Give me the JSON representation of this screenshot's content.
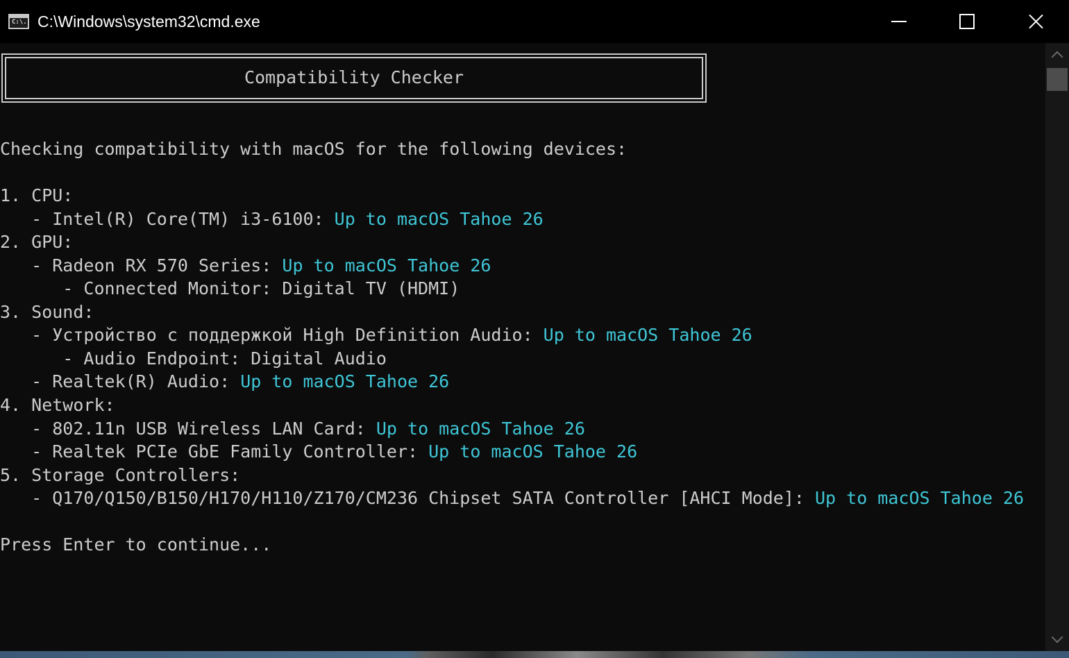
{
  "window": {
    "title": "C:\\Windows\\system32\\cmd.exe",
    "icon_text": "C:\\.",
    "icon": "console-icon",
    "controls": [
      "minimize-icon",
      "maximize-icon",
      "close-icon"
    ]
  },
  "console": {
    "banner": "Compatibility Checker",
    "lines": [
      {
        "text": "Checking compatibility with macOS for the following devices:",
        "status": ""
      },
      {
        "text": "",
        "status": ""
      },
      {
        "text": "1. CPU:",
        "status": ""
      },
      {
        "text": "   - Intel(R) Core(TM) i3-6100: ",
        "status": "Up to macOS Tahoe 26"
      },
      {
        "text": "2. GPU:",
        "status": ""
      },
      {
        "text": "   - Radeon RX 570 Series: ",
        "status": "Up to macOS Tahoe 26"
      },
      {
        "text": "      - Connected Monitor: Digital TV (HDMI)",
        "status": ""
      },
      {
        "text": "3. Sound:",
        "status": ""
      },
      {
        "text": "   - Устройство с поддержкой High Definition Audio: ",
        "status": "Up to macOS Tahoe 26"
      },
      {
        "text": "      - Audio Endpoint: Digital Audio",
        "status": ""
      },
      {
        "text": "   - Realtek(R) Audio: ",
        "status": "Up to macOS Tahoe 26"
      },
      {
        "text": "4. Network:",
        "status": ""
      },
      {
        "text": "   - 802.11n USB Wireless LAN Card: ",
        "status": "Up to macOS Tahoe 26"
      },
      {
        "text": "   - Realtek PCIe GbE Family Controller: ",
        "status": "Up to macOS Tahoe 26"
      },
      {
        "text": "5. Storage Controllers:",
        "status": ""
      },
      {
        "text": "   - Q170/Q150/B150/H170/H110/Z170/CM236 Chipset SATA Controller [AHCI Mode]: ",
        "status": "Up to macOS Tahoe 26"
      },
      {
        "text": "",
        "status": ""
      },
      {
        "text": "Press Enter to continue...",
        "status": ""
      }
    ]
  },
  "colors": {
    "background": "#0c0c0c",
    "text": "#cccccc",
    "status_text": "#3fc6d6"
  }
}
